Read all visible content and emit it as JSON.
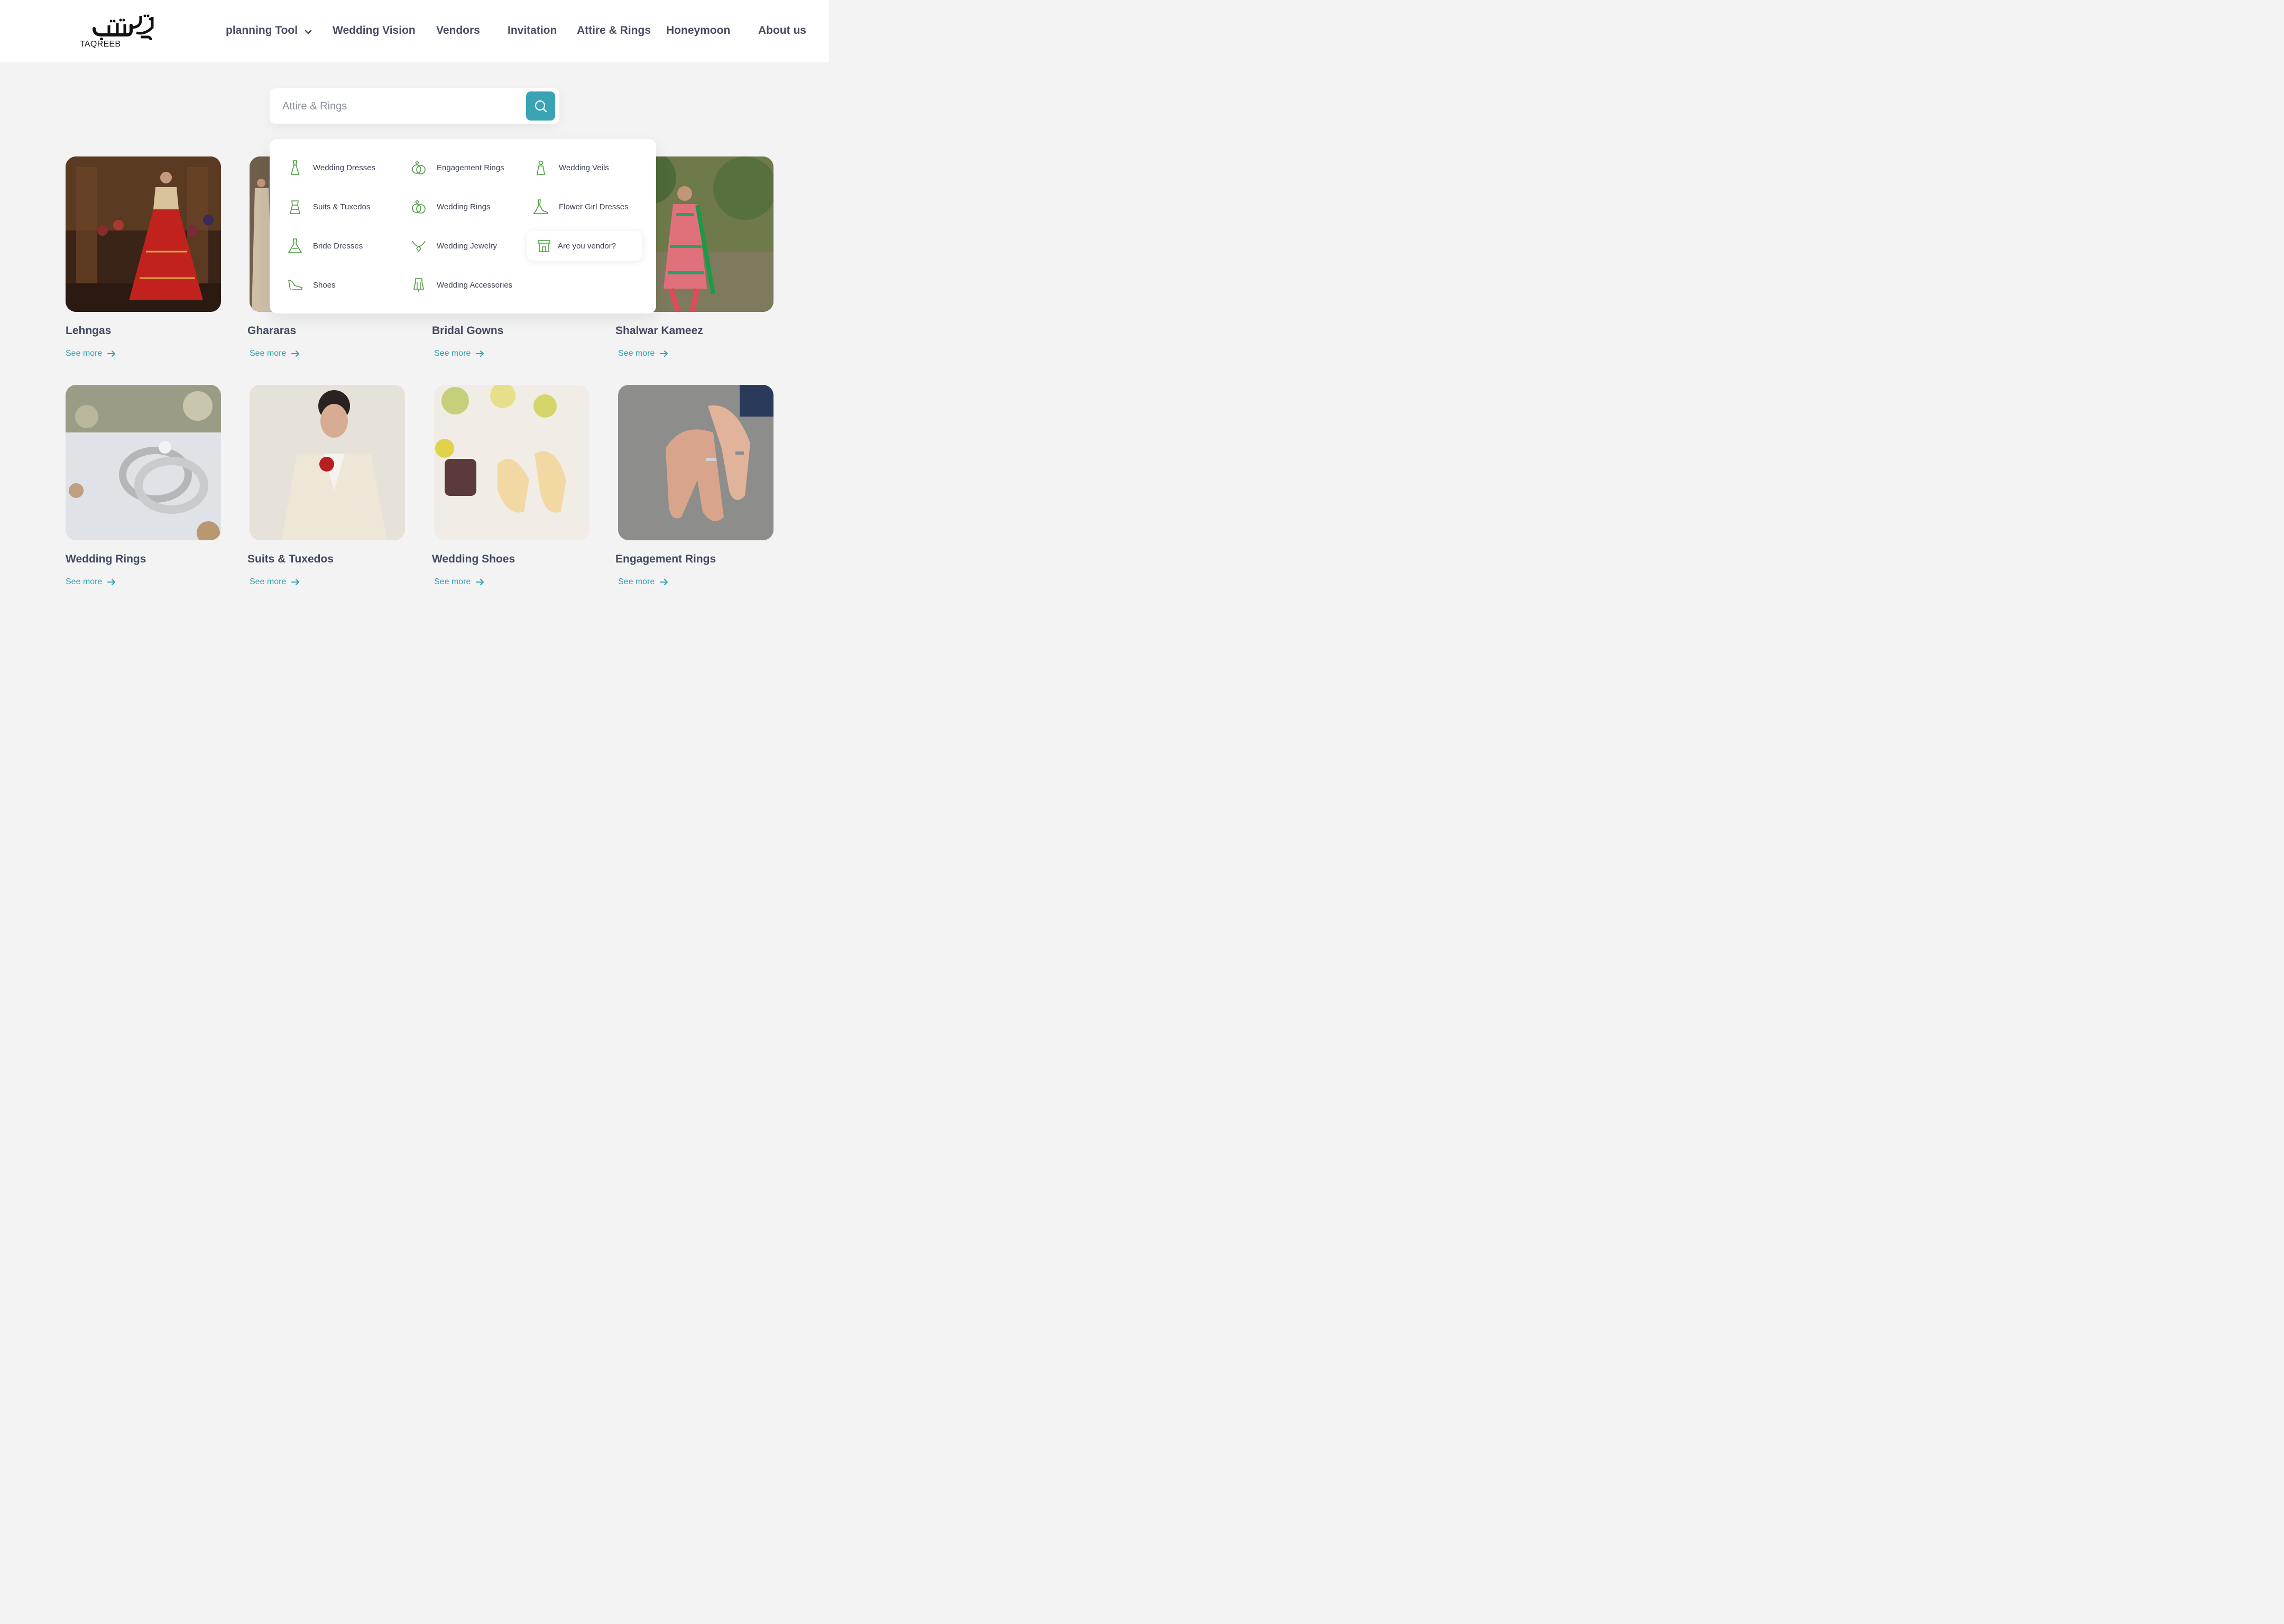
{
  "brand": {
    "logo_text": "TAQREEB"
  },
  "nav": {
    "planning_tool": "planning Tool",
    "wedding_vision": "Wedding Vision",
    "vendors": "Vendors",
    "invitation": "Invitation",
    "attire_rings": "Attire & Rings",
    "honeymoon": "Honeymoon",
    "about_us": "About us"
  },
  "search": {
    "placeholder": "Attire & Rings"
  },
  "dropdown": {
    "items": [
      "Wedding Dresses",
      "Suits & Tuxedos",
      "Bride Dresses",
      "Shoes",
      "Engagement Rings",
      "Wedding Rings",
      "Wedding Jewelry",
      "Wedding Accessories",
      "Wedding Veils",
      "Flower Girl Dresses",
      "Are you vendor?"
    ]
  },
  "cards": [
    {
      "title": "Lehngas",
      "link": "See more"
    },
    {
      "title": "Ghararas",
      "link": "See more"
    },
    {
      "title": "Bridal Gowns",
      "link": "See more"
    },
    {
      "title": "Shalwar Kameez",
      "link": "See more"
    },
    {
      "title": "Wedding Rings",
      "link": "See more"
    },
    {
      "title": "Suits & Tuxedos",
      "link": "See more"
    },
    {
      "title": "Wedding Shoes",
      "link": "See more"
    },
    {
      "title": "Engagement Rings",
      "link": "See more"
    }
  ],
  "colors": {
    "accent": "#3aa4b5",
    "link": "#2fa3b3",
    "icon_green": "#4a9a3e",
    "text_dark": "#424a60",
    "background": "#f3f3f4"
  }
}
